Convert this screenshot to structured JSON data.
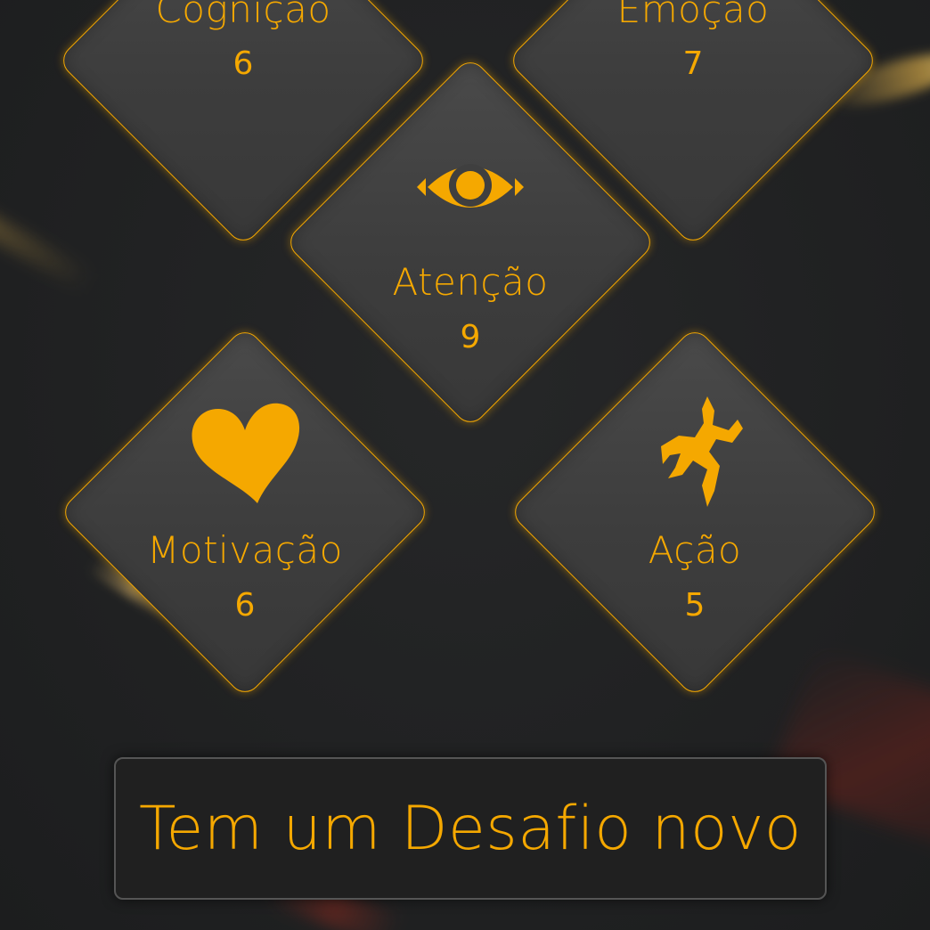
{
  "accent_color": "#f5a800",
  "tiles": {
    "cognicao": {
      "label": "Cognição",
      "value": "6"
    },
    "emocao": {
      "label": "Emoção",
      "value": "7"
    },
    "atencao": {
      "label": "Atenção",
      "value": "9",
      "icon": "eye-icon"
    },
    "motivacao": {
      "label": "Motivação",
      "value": "6",
      "icon": "heart-icon"
    },
    "acao": {
      "label": "Ação",
      "value": "5",
      "icon": "running-figure-icon"
    }
  },
  "challenge_button": {
    "label": "Tem um Desafio novo"
  }
}
